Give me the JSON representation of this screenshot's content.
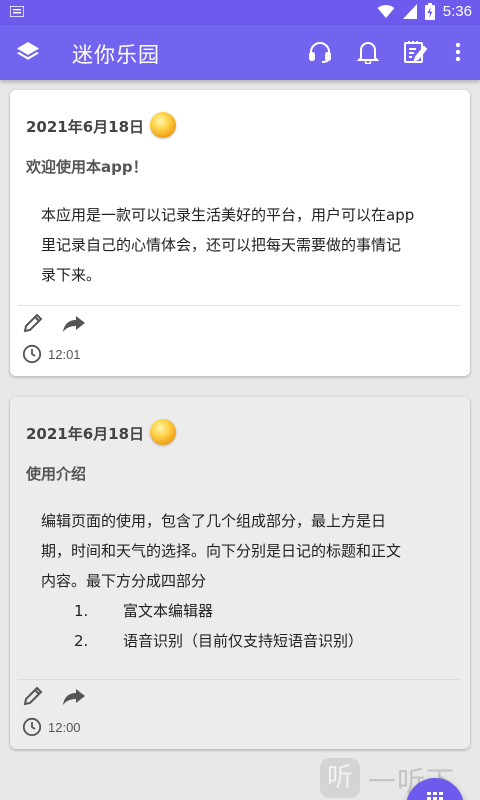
{
  "status_bar": {
    "time": "5:36"
  },
  "app_bar": {
    "title": "迷你乐园"
  },
  "cards": [
    {
      "date": "2021年6月18日",
      "title": "欢迎使用本app！",
      "body_lines": [
        "本应用是一款可以记录生活美好的平台，用户可以在app",
        "里记录自己的心情体会，还可以把每天需要做的事情记",
        "录下来。"
      ],
      "time": "12:01"
    },
    {
      "date": "2021年6月18日",
      "title": "使用介绍",
      "body_lines": [
        "编辑页面的使用，包含了几个组成部分，最上方是日",
        "期，时间和天气的选择。向下分别是日记的标题和正文",
        "内容。最下方分成四部分"
      ],
      "list": [
        {
          "num": "1.",
          "text": "富文本编辑器"
        },
        {
          "num": "2.",
          "text": "语音识别（目前仅支持短语音识别）"
        }
      ],
      "time": "12:00"
    }
  ],
  "watermark": {
    "text": "一听下载",
    "icon_char": "听"
  },
  "colors": {
    "primary": "#7264ef",
    "status_bar": "#6c5bec",
    "background": "#e9e8e8"
  }
}
